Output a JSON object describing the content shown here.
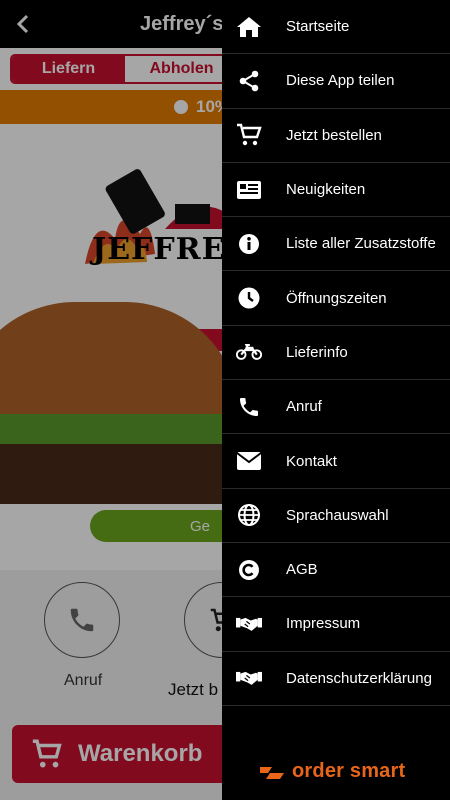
{
  "app": {
    "title": "Jeffrey´s B",
    "tabs": [
      {
        "label": "Liefern"
      },
      {
        "label": "Abholen"
      }
    ],
    "promo_text": "10%",
    "logo_text": "JEFFREY'",
    "green_button": "Ge",
    "actions": [
      {
        "label": "Anruf"
      },
      {
        "label": "Jetzt b"
      }
    ],
    "cart_label": "Warenkorb"
  },
  "menu": {
    "items": [
      {
        "label": "Startseite",
        "icon": "home-icon"
      },
      {
        "label": "Diese App teilen",
        "icon": "share-icon"
      },
      {
        "label": "Jetzt bestellen",
        "icon": "cart-icon"
      },
      {
        "label": "Neuigkeiten",
        "icon": "news-icon"
      },
      {
        "label": "Liste aller Zusatzstoffe",
        "icon": "info-icon"
      },
      {
        "label": "Öffnungszeiten",
        "icon": "clock-icon"
      },
      {
        "label": "Lieferinfo",
        "icon": "motorcycle-icon"
      },
      {
        "label": "Anruf",
        "icon": "phone-icon"
      },
      {
        "label": "Kontakt",
        "icon": "envelope-icon"
      },
      {
        "label": "Sprachauswahl",
        "icon": "globe-icon"
      },
      {
        "label": "AGB",
        "icon": "copyright-icon"
      },
      {
        "label": "Impressum",
        "icon": "handshake-icon"
      },
      {
        "label": "Datenschutzerklärung",
        "icon": "handshake-icon"
      }
    ]
  },
  "brand": {
    "text": "order smart"
  },
  "colors": {
    "accent_red": "#c8102e",
    "promo_orange": "#e07b00",
    "brand_orange": "#e8651a",
    "drawer_bg": "#000000"
  }
}
